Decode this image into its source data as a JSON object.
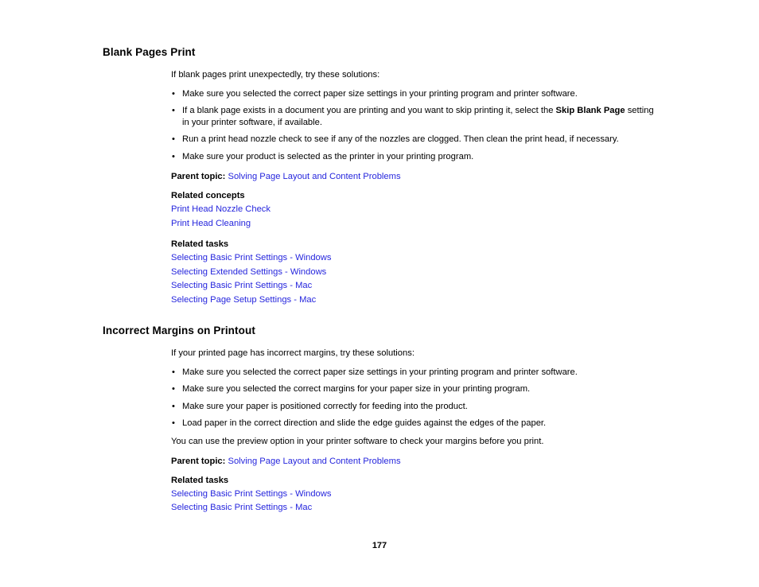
{
  "page": {
    "number": "177",
    "link_color": "#2626dd",
    "text_color": "#000000",
    "background": "#ffffff"
  },
  "sections": [
    {
      "title": "Blank Pages Print",
      "intro": "If blank pages print unexpectedly, try these solutions:",
      "bullets": [
        {
          "pre": "Make sure you selected the correct paper size settings in your printing program and printer software.",
          "bold": "",
          "post": ""
        },
        {
          "pre": "If a blank page exists in a document you are printing and you want to skip printing it, select the ",
          "bold": "Skip Blank Page",
          "post": " setting in your printer software, if available."
        },
        {
          "pre": "Run a print head nozzle check to see if any of the nozzles are clogged. Then clean the print head, if necessary.",
          "bold": "",
          "post": ""
        },
        {
          "pre": "Make sure your product is selected as the printer in your printing program.",
          "bold": "",
          "post": ""
        }
      ],
      "note": "",
      "parent_topic_label": "Parent topic:",
      "parent_topic_link": "Solving Page Layout and Content Problems",
      "related_groups": [
        {
          "heading": "Related concepts",
          "links": [
            "Print Head Nozzle Check",
            "Print Head Cleaning"
          ]
        },
        {
          "heading": "Related tasks",
          "links": [
            "Selecting Basic Print Settings - Windows",
            "Selecting Extended Settings - Windows",
            "Selecting Basic Print Settings - Mac",
            "Selecting Page Setup Settings - Mac"
          ]
        }
      ]
    },
    {
      "title": "Incorrect Margins on Printout",
      "intro": "If your printed page has incorrect margins, try these solutions:",
      "bullets": [
        {
          "pre": "Make sure you selected the correct paper size settings in your printing program and printer software.",
          "bold": "",
          "post": ""
        },
        {
          "pre": "Make sure you selected the correct margins for your paper size in your printing program.",
          "bold": "",
          "post": ""
        },
        {
          "pre": "Make sure your paper is positioned correctly for feeding into the product.",
          "bold": "",
          "post": ""
        },
        {
          "pre": "Load paper in the correct direction and slide the edge guides against the edges of the paper.",
          "bold": "",
          "post": ""
        }
      ],
      "note": "You can use the preview option in your printer software to check your margins before you print.",
      "parent_topic_label": "Parent topic:",
      "parent_topic_link": "Solving Page Layout and Content Problems",
      "related_groups": [
        {
          "heading": "Related tasks",
          "links": [
            "Selecting Basic Print Settings - Windows",
            "Selecting Basic Print Settings - Mac"
          ]
        }
      ]
    }
  ],
  "bullet_glyph": "•"
}
